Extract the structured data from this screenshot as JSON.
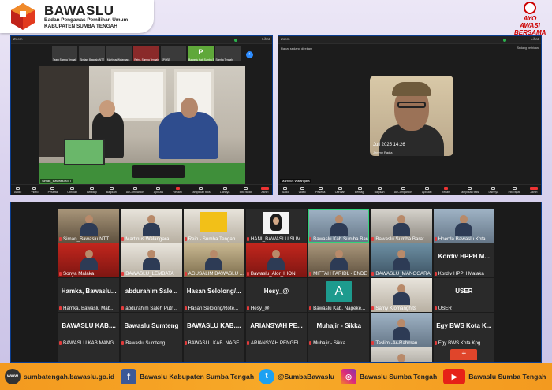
{
  "brand": {
    "title": "BAWASLU",
    "subtitle1": "Badan Pengawas Pemilihan Umum",
    "subtitle2": "KABUPATEN SUMBA TENGAH",
    "corner_badge": "AYO AWASI BERSAMA"
  },
  "colors": {
    "brand_orange": "#f39a1f",
    "zoom_blue": "#0a3d8f",
    "zoom_dark": "#1b1b1b",
    "mic_red": "#e23b3b"
  },
  "left_window": {
    "top_left_label": "Zoom",
    "top_right_label": "Lihat",
    "strip_tiles": [
      {
        "name": "Team Sumba Tengah",
        "style": "dark"
      },
      {
        "name": "Simian_Bawaslu NTT",
        "style": "dark"
      },
      {
        "name": "Martinus Walangara",
        "style": "dark"
      },
      {
        "name": "Rein - Sumba Tengah",
        "style": "red"
      },
      {
        "name": "SPOSE",
        "style": "dark"
      },
      {
        "name": "Bawaslu Kab Sumba Barat",
        "style": "green",
        "letter": "P"
      },
      {
        "name": "Sumba Tengah",
        "style": "dark"
      }
    ],
    "speaker_name": "Siman_Bawaslu NTT"
  },
  "right_window": {
    "top_left_label": "Zoom",
    "top_right_label": "Lihat",
    "notification": "Rapat sedang direkam",
    "side_label": "Sedang berbicara",
    "speaker_date": "Juli 2025 14:26",
    "speaker_overlay_name": "Jemmy Radja",
    "speaker_name": "Martinus Walangara"
  },
  "toolbar": {
    "items": [
      "Audio",
      "Video",
      "Peserta",
      "Obrolan",
      "Berbagi",
      "Bagikan",
      "AI Companion",
      "Aplikasi",
      "Rekam",
      "Tampilkan teks",
      "Lainnya",
      "Info rapat",
      "Akhiri"
    ]
  },
  "gallery": {
    "cells": [
      {
        "kind": "photo",
        "tone": "g5",
        "name": "Siman_Bawaslu NTT"
      },
      {
        "kind": "photo",
        "tone": "g2",
        "name": "Martinus Walangara"
      },
      {
        "kind": "poster",
        "name": "Rein - Sumba Tengah"
      },
      {
        "kind": "hijab",
        "name": "HANI_BAWASLU SUM..."
      },
      {
        "kind": "photo",
        "tone": "g6",
        "name": "Bawaslu Kab Sumba Barat",
        "active": true
      },
      {
        "kind": "photo",
        "tone": "g1",
        "name": "Bawaslu Sumba Barat..."
      },
      {
        "kind": "photo",
        "tone": "g6",
        "name": "Hoerda Bawaslu Kota..."
      },
      {
        "kind": "photo",
        "tone": "g7",
        "name": "Sonya Malaka"
      },
      {
        "kind": "photo",
        "tone": "g2",
        "name": "BAWASLU_LEMBATA"
      },
      {
        "kind": "photo",
        "tone": "g3",
        "name": "AGUSALIM BAWASLU ..."
      },
      {
        "kind": "photo",
        "tone": "g7",
        "name": "Bawaslu_Alor_IHON"
      },
      {
        "kind": "photo",
        "tone": "g5",
        "name": "MIFTAH FARIDL - ENDE"
      },
      {
        "kind": "photo",
        "tone": "g4",
        "name": "BAWASLU_MANGGARAI"
      },
      {
        "kind": "text",
        "big": "Kordiv HPPH M...",
        "name": "Kordiv HPPH Malaka"
      },
      {
        "kind": "text",
        "big": "Hamka, Bawaslu...",
        "name": "Hamka, Bawaslu Mab..."
      },
      {
        "kind": "text",
        "big": "abdurahim Sale...",
        "name": "abdurahim Saleh Putr..."
      },
      {
        "kind": "text",
        "big": "Hasan Selolong/...",
        "name": "Hasan Selolong/Rote..."
      },
      {
        "kind": "text",
        "big": "Hesy_@",
        "name": "Hesy_@"
      },
      {
        "kind": "avatarA",
        "letter": "A",
        "name": "Bawaslu Kab. Nageke..."
      },
      {
        "kind": "photo",
        "tone": "g2",
        "name": "Samy Klomanghits"
      },
      {
        "kind": "text",
        "big": "USER",
        "name": "USER"
      },
      {
        "kind": "text",
        "big": "BAWASLU KAB....",
        "name": "BAWASLU KAB MANG..."
      },
      {
        "kind": "text",
        "big": "Bawaslu Sumteng",
        "name": "Bawaslu Sumteng"
      },
      {
        "kind": "text",
        "big": "BAWASLU KAB....",
        "name": "BAWASLU KAB. NAGE..."
      },
      {
        "kind": "text",
        "big": "ARIANSYAH PE...",
        "name": "ARIANSYAH PENGEL..."
      },
      {
        "kind": "text",
        "big": "Muhajir - Sikka",
        "name": "Muhajir - Sikka"
      },
      {
        "kind": "photo",
        "tone": "g6",
        "name": "Taslim -Ar-Rahman"
      },
      {
        "kind": "text",
        "big": "Egy BWS Kota K...",
        "name": "Egy BWS Kota Kpg"
      },
      {
        "kind": "empty",
        "name": ""
      },
      {
        "kind": "empty",
        "name": ""
      },
      {
        "kind": "empty",
        "name": ""
      },
      {
        "kind": "empty",
        "name": ""
      },
      {
        "kind": "empty",
        "name": ""
      },
      {
        "kind": "photo",
        "tone": "g1",
        "name": ""
      },
      {
        "kind": "avatarRed",
        "letter": "+",
        "name": ""
      }
    ]
  },
  "footer": {
    "website": "sumbatengah.bawaslu.go.id",
    "facebook": "Bawaslu Kabupaten Sumba Tengah",
    "twitter": "@SumbaBawaslu",
    "instagram": "Bawaslu Sumba Tengah",
    "youtube": "Bawaslu Sumba Tengah"
  }
}
